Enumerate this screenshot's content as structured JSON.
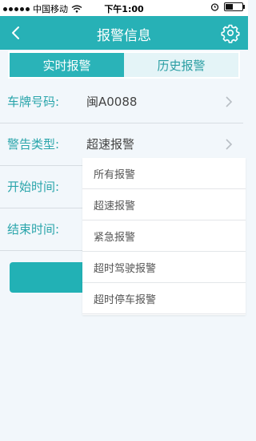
{
  "status_bar": {
    "carrier": "中国移动",
    "time": "下午1:00"
  },
  "header": {
    "title": "报警信息"
  },
  "tabs": [
    {
      "label": "实时报警",
      "active": true
    },
    {
      "label": "历史报警",
      "active": false
    }
  ],
  "form": {
    "plate_label": "车牌号码:",
    "plate_value": "闽A0088",
    "type_label": "警告类型:",
    "type_value": "超速报警",
    "start_label": "开始时间:",
    "end_label": "结束时间:"
  },
  "dropdown": {
    "options": [
      "所有报警",
      "超速报警",
      "紧急报警",
      "超时驾驶报警",
      "超时停车报警"
    ]
  },
  "colors": {
    "accent": "#27b1b6",
    "label": "#2aa5ab"
  }
}
